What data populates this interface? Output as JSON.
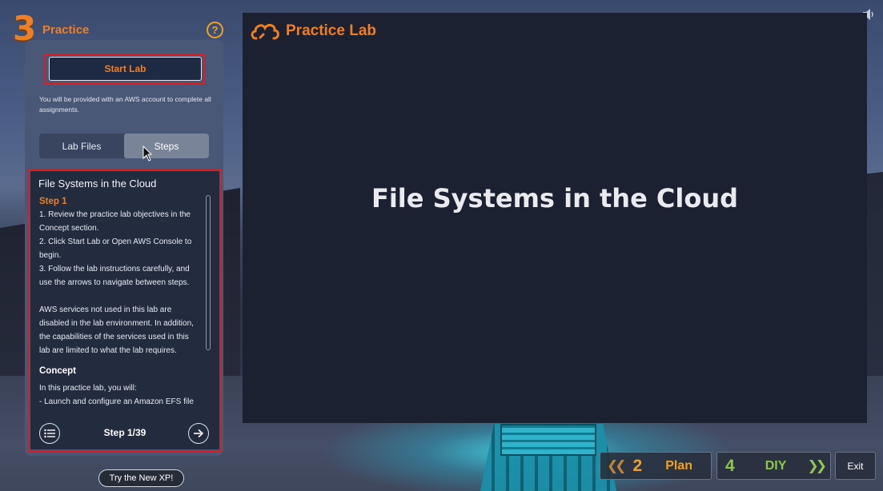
{
  "sidebar": {
    "step_number": "3",
    "title": "Practice",
    "help_label": "?",
    "start_lab_label": "Start Lab",
    "start_lab_note": "You will be provided with an AWS account to complete all assignments.",
    "tabs": [
      {
        "label": "Lab Files"
      },
      {
        "label": "Steps"
      }
    ],
    "steps": {
      "title": "File Systems in the Cloud",
      "step_heading": "Step 1",
      "lines": [
        "1. Review the practice lab objectives in the",
        "Concept section.",
        "2. Click Start Lab or Open AWS Console to",
        "begin.",
        "3. Follow the lab instructions carefully, and",
        "use the arrows to navigate between steps."
      ],
      "note_lines": [
        "AWS services not used in this lab are",
        "disabled in the lab environment. In addition,",
        "the capabilities of the services used in this",
        "lab are limited to what the lab requires."
      ],
      "concept_heading": "Concept",
      "concept_lines": [
        "In this practice lab, you will:",
        "- Launch and configure an Amazon EFS file"
      ],
      "counter": "Step 1/39"
    },
    "try_xp_label": "Try the New XP!"
  },
  "main": {
    "brand": "Practice Lab",
    "title": "File Systems in the Cloud"
  },
  "nav": {
    "prev_number": "2",
    "prev_label": "Plan",
    "next_number": "4",
    "next_label": "DIY",
    "exit_label": "Exit"
  },
  "colors": {
    "accent_orange": "#f07f21",
    "accent_green": "#8cc84b",
    "highlight_red": "#e11b1b",
    "panel_dark": "#232b3f",
    "main_bg": "#1b2130"
  },
  "icons": [
    "speaker-icon",
    "help-icon",
    "cloud-logo-icon",
    "list-icon",
    "arrow-right-icon",
    "mouse-cursor-icon",
    "chevron-left-icon",
    "chevron-right-icon"
  ]
}
